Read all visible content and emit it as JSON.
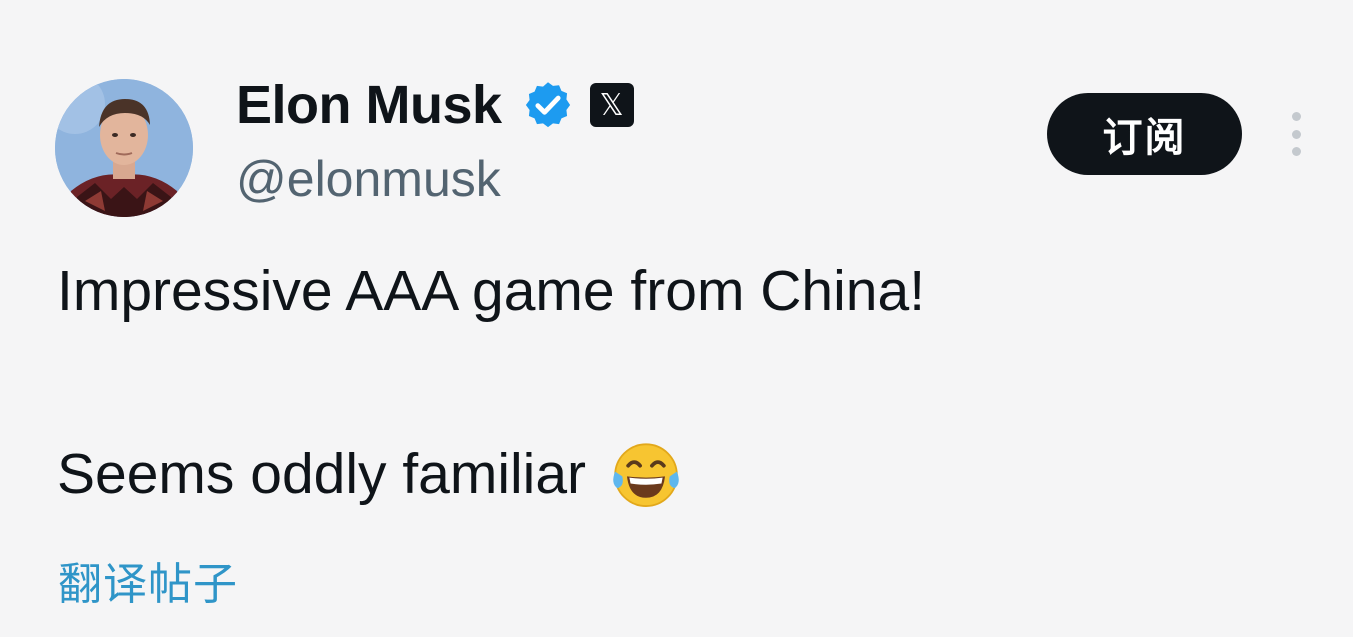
{
  "author": {
    "display_name": "Elon Musk",
    "handle": "@elonmusk",
    "avatar_icon": "profile-photo",
    "verified_icon": "verified-badge-icon",
    "affiliate_badge": "𝕏"
  },
  "actions": {
    "subscribe_label": "订阅",
    "more_icon": "more-options-icon"
  },
  "tweet": {
    "line_1": "Impressive AAA game from China!",
    "line_2": "Seems oddly familiar",
    "emoji": "face-with-tears-of-joy"
  },
  "footer": {
    "translate_label": "翻译帖子"
  },
  "colors": {
    "background": "#f5f5f6",
    "text": "#0f1419",
    "secondary_text": "#536471",
    "verified_blue": "#1d9bf0",
    "link_blue": "#2f95c8",
    "button_dark": "#0f1419"
  }
}
